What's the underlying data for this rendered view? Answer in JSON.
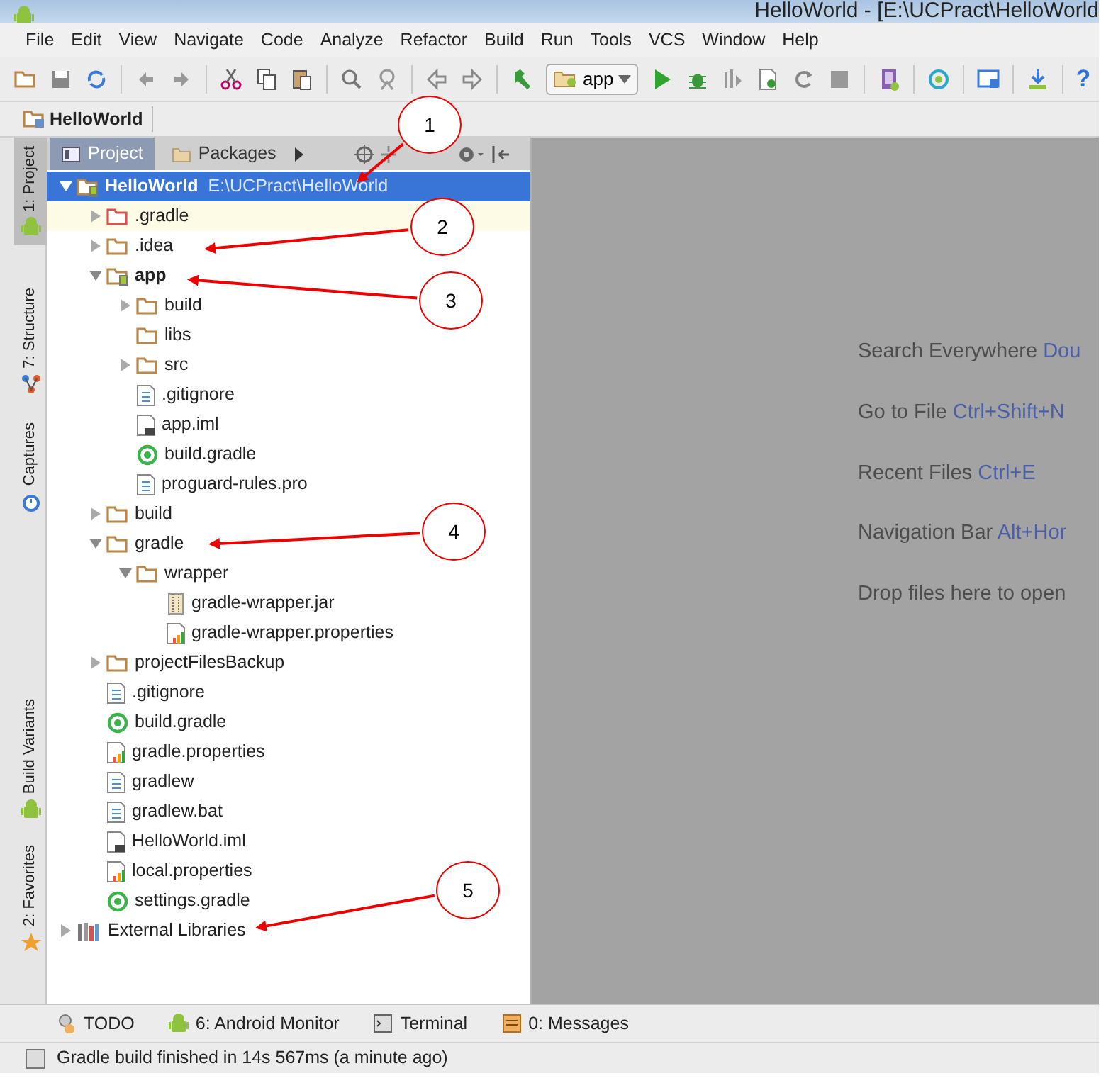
{
  "window": {
    "title": "HelloWorld - [E:\\UCPract\\HelloWorld"
  },
  "menu": [
    "File",
    "Edit",
    "View",
    "Navigate",
    "Code",
    "Analyze",
    "Refactor",
    "Build",
    "Run",
    "Tools",
    "VCS",
    "Window",
    "Help"
  ],
  "toolbar": {
    "run_config": "app",
    "help": "?"
  },
  "breadcrumb": [
    "HelloWorld"
  ],
  "side_tabs": [
    {
      "label": "1: Project",
      "selected": true,
      "kind": "android"
    },
    {
      "label": "7: Structure",
      "selected": false,
      "kind": "structure"
    },
    {
      "label": "Captures",
      "selected": false,
      "kind": "captures"
    },
    {
      "label": "Build Variants",
      "selected": false,
      "kind": "android"
    },
    {
      "label": "2: Favorites",
      "selected": false,
      "kind": "star"
    }
  ],
  "panel_tabs": [
    {
      "label": "Project",
      "selected": true
    },
    {
      "label": "Packages",
      "selected": false
    }
  ],
  "tree": [
    {
      "label": "HelloWorld",
      "path": "E:\\UCPract\\HelloWorld",
      "kind": "module",
      "expanded": true,
      "selected": true,
      "children": [
        {
          "label": ".gradle",
          "kind": "excluded",
          "expanded": false,
          "selected": false
        },
        {
          "label": ".idea",
          "kind": "folder",
          "expanded": false,
          "selected": false
        },
        {
          "label": "app",
          "kind": "module",
          "expanded": true,
          "selected": false,
          "children": [
            {
              "label": "build",
              "kind": "folder",
              "expanded": false,
              "selected": false
            },
            {
              "label": "libs",
              "kind": "folder",
              "selected": false
            },
            {
              "label": "src",
              "kind": "folder",
              "expanded": false,
              "selected": false
            },
            {
              "label": ".gitignore",
              "kind": "text",
              "selected": false
            },
            {
              "label": "app.iml",
              "kind": "iml",
              "selected": false
            },
            {
              "label": "build.gradle",
              "kind": "gradle",
              "selected": false
            },
            {
              "label": "proguard-rules.pro",
              "kind": "text",
              "selected": false
            }
          ]
        },
        {
          "label": "build",
          "kind": "folder",
          "expanded": false,
          "selected": false
        },
        {
          "label": "gradle",
          "kind": "folder",
          "expanded": true,
          "selected": false,
          "children": [
            {
              "label": "wrapper",
              "kind": "folder",
              "expanded": true,
              "selected": false,
              "children": [
                {
                  "label": "gradle-wrapper.jar",
                  "kind": "jar",
                  "selected": false
                },
                {
                  "label": "gradle-wrapper.properties",
                  "kind": "properties",
                  "selected": false
                }
              ]
            }
          ]
        },
        {
          "label": "projectFilesBackup",
          "kind": "folder",
          "expanded": false,
          "selected": false
        },
        {
          "label": ".gitignore",
          "kind": "text",
          "selected": false
        },
        {
          "label": "build.gradle",
          "kind": "gradle",
          "selected": false
        },
        {
          "label": "gradle.properties",
          "kind": "properties",
          "selected": false
        },
        {
          "label": "gradlew",
          "kind": "text",
          "selected": false
        },
        {
          "label": "gradlew.bat",
          "kind": "text",
          "selected": false
        },
        {
          "label": "HelloWorld.iml",
          "kind": "iml",
          "selected": false
        },
        {
          "label": "local.properties",
          "kind": "properties",
          "selected": false
        },
        {
          "label": "settings.gradle",
          "kind": "gradle",
          "selected": false
        }
      ]
    },
    {
      "label": "External Libraries",
      "kind": "libraries",
      "expanded": false,
      "selected": false
    }
  ],
  "editor_hints": [
    {
      "label": "Search Everywhere",
      "shortcut": "Dou"
    },
    {
      "label": "Go to File",
      "shortcut": "Ctrl+Shift+N"
    },
    {
      "label": "Recent Files",
      "shortcut": "Ctrl+E"
    },
    {
      "label": "Navigation Bar",
      "shortcut": "Alt+Hor"
    },
    {
      "label": "Drop files here to open"
    }
  ],
  "bottom_tabs": [
    {
      "label": "TODO",
      "kind": "todo"
    },
    {
      "label": "6: Android Monitor",
      "kind": "android"
    },
    {
      "label": "Terminal",
      "kind": "terminal"
    },
    {
      "label": "0: Messages",
      "kind": "messages"
    }
  ],
  "status_bar": "Gradle build finished in 14s 567ms (a minute ago)",
  "callouts": [
    "1",
    "2",
    "3",
    "4",
    "5"
  ]
}
